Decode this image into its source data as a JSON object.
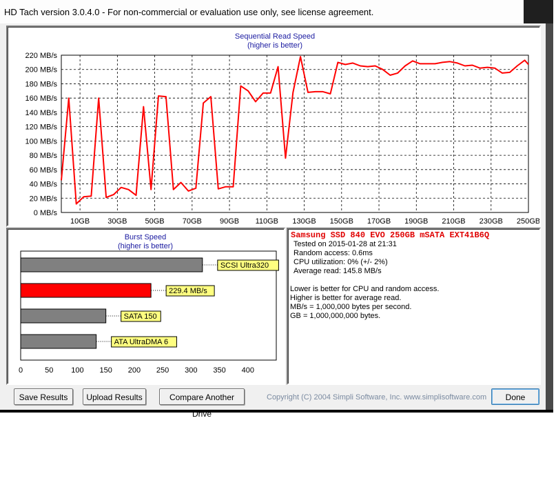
{
  "window": {
    "title": "HD Tach version 3.0.4.0  - For non-commercial or evaluation use only, see license agreement."
  },
  "chart_data": [
    {
      "type": "line",
      "title": "Sequential Read Speed",
      "subtitle": "(higher is better)",
      "x_ticks": [
        "10GB",
        "30GB",
        "50GB",
        "70GB",
        "90GB",
        "110GB",
        "130GB",
        "150GB",
        "170GB",
        "190GB",
        "210GB",
        "230GB",
        "250GB"
      ],
      "y_ticks": [
        "0 MB/s",
        "20 MB/s",
        "40 MB/s",
        "60 MB/s",
        "80 MB/s",
        "100 MB/s",
        "120 MB/s",
        "140 MB/s",
        "160 MB/s",
        "180 MB/s",
        "200 MB/s",
        "220 MB/s"
      ],
      "xlim": [
        0,
        250
      ],
      "ylim": [
        0,
        220
      ],
      "grid": true,
      "series": [
        {
          "color": "#ff0000",
          "x": [
            0,
            4,
            8,
            12,
            16,
            20,
            24,
            28,
            32,
            36,
            40,
            44,
            48,
            52,
            56,
            60,
            64,
            68,
            72,
            76,
            80,
            84,
            88,
            92,
            96,
            100,
            104,
            108,
            112,
            116,
            120,
            124,
            128,
            132,
            136,
            140,
            144,
            148,
            152,
            156,
            160,
            164,
            168,
            172,
            176,
            180,
            184,
            188,
            192,
            196,
            200,
            204,
            208,
            212,
            216,
            220,
            224,
            228,
            232,
            236,
            240,
            244,
            248,
            250
          ],
          "y": [
            45,
            160,
            12,
            22,
            23,
            160,
            21,
            25,
            35,
            32,
            24,
            148,
            32,
            163,
            162,
            32,
            42,
            30,
            34,
            153,
            162,
            33,
            36,
            36,
            177,
            170,
            155,
            167,
            167,
            204,
            76,
            168,
            218,
            168,
            169,
            169,
            166,
            210,
            207,
            209,
            205,
            204,
            205,
            200,
            192,
            195,
            205,
            212,
            208,
            208,
            208,
            210,
            211,
            209,
            205,
            206,
            202,
            203,
            202,
            195,
            196,
            205,
            213,
            207
          ]
        }
      ]
    },
    {
      "type": "bar",
      "title": "Burst Speed",
      "subtitle": "(higher is better)",
      "categories": [
        "SCSI Ultra320",
        "229.4 MB/s",
        "SATA 150",
        "ATA UltraDMA 6"
      ],
      "values": [
        320,
        229.4,
        150,
        133
      ],
      "bar_colors": [
        "#808080",
        "#ff0000",
        "#808080",
        "#808080"
      ],
      "label_bg": "#ffff80",
      "x_ticks": [
        "0",
        "50",
        "100",
        "150",
        "200",
        "250",
        "300",
        "350",
        "400"
      ],
      "xlim": [
        0,
        450
      ]
    }
  ],
  "info": {
    "drive_name": "Samsung SSD 840 EVO 250GB mSATA EXT41B6Q",
    "tested_on": "Tested on 2015-01-28 at 21:31",
    "random_access": "Random access: 0.6ms",
    "cpu": "CPU utilization: 0% (+/- 2%)",
    "avg_read": "Average read: 145.8 MB/s",
    "note1": "Lower is better for CPU and random access.",
    "note2": "Higher is better for average read.",
    "note3": "MB/s = 1,000,000 bytes per second.",
    "note4": "GB = 1,000,000,000 bytes."
  },
  "buttons": {
    "save": "Save Results",
    "upload": "Upload Results",
    "compare": "Compare Another Drive",
    "done": "Done"
  },
  "copyright": "Copyright (C) 2004 Simpli Software, Inc. www.simplisoftware.com"
}
